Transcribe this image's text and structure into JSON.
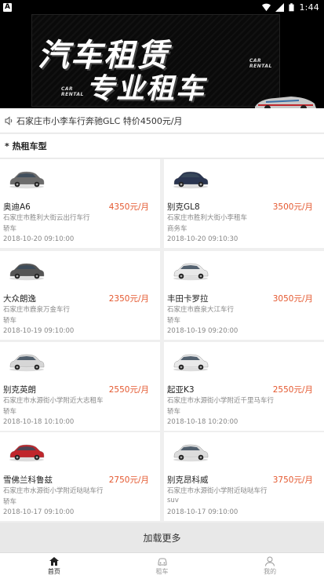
{
  "status_bar": {
    "time": "1:44",
    "app_badge": "A"
  },
  "banner": {
    "line1": "汽车租赁",
    "line2": "专业租车",
    "tag_left": "CAR RENTAL",
    "tag_right": "CAR RENTAL"
  },
  "notice": {
    "text": "石家庄市小李车行奔驰GLC 特价4500元/月"
  },
  "section": {
    "title": "* 热租车型"
  },
  "cars": [
    {
      "name": "奥迪A6",
      "price": "4350元/月",
      "addr": "石家庄市胜利大街云出行车行",
      "type": "轿车",
      "date": "2018-10-20 09:10:00",
      "color": "#6b6b6b"
    },
    {
      "name": "别克GL8",
      "price": "3500元/月",
      "addr": "石家庄市胜利大街小李租车",
      "type": "商务车",
      "date": "2018-10-20 09:10:30",
      "color": "#2a3550"
    },
    {
      "name": "大众朗逸",
      "price": "2350元/月",
      "addr": "石家庄市鹿泉万金车行",
      "type": "轿车",
      "date": "2018-10-19 09:10:00",
      "color": "#555"
    },
    {
      "name": "丰田卡罗拉",
      "price": "3050元/月",
      "addr": "石家庄市鹿泉大江车行",
      "type": "轿车",
      "date": "2018-10-19 09:20:00",
      "color": "#e8e8e8"
    },
    {
      "name": "别克英朗",
      "price": "2550元/月",
      "addr": "石家庄市水源街小学附近大志租车",
      "type": "轿车",
      "date": "2018-10-18 10:10:00",
      "color": "#d6d6d6"
    },
    {
      "name": "起亚K3",
      "price": "2550元/月",
      "addr": "石家庄市水源街小学附近千里马车行",
      "type": "轿车",
      "date": "2018-10-18 10:20:00",
      "color": "#e9e9e9"
    },
    {
      "name": "雪佛兰科鲁兹",
      "price": "2750元/月",
      "addr": "石家庄市水源街小学附近哒哒车行",
      "type": "轿车",
      "date": "2018-10-17 09:10:00",
      "color": "#c0262c"
    },
    {
      "name": "别克昂科威",
      "price": "3750元/月",
      "addr": "石家庄市水源街小学附近哒哒车行",
      "type": "suv",
      "date": "2018-10-17 09:10:00",
      "color": "#dcdcdc"
    }
  ],
  "load_more": "加载更多",
  "tabs": [
    {
      "label": "首页",
      "icon": "home-icon"
    },
    {
      "label": "租车",
      "icon": "car-icon"
    },
    {
      "label": "我的",
      "icon": "person-icon"
    }
  ]
}
